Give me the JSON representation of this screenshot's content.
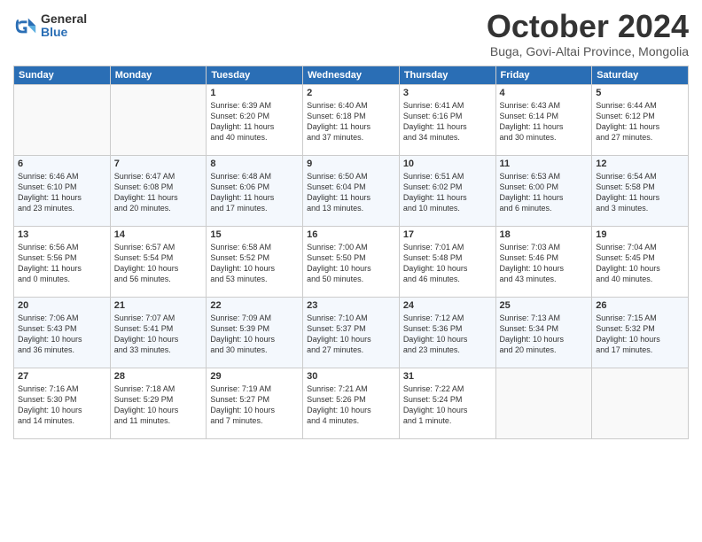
{
  "header": {
    "logo_general": "General",
    "logo_blue": "Blue",
    "month_title": "October 2024",
    "location": "Buga, Govi-Altai Province, Mongolia"
  },
  "days_of_week": [
    "Sunday",
    "Monday",
    "Tuesday",
    "Wednesday",
    "Thursday",
    "Friday",
    "Saturday"
  ],
  "weeks": [
    [
      {
        "day": "",
        "content": ""
      },
      {
        "day": "",
        "content": ""
      },
      {
        "day": "1",
        "content": "Sunrise: 6:39 AM\nSunset: 6:20 PM\nDaylight: 11 hours\nand 40 minutes."
      },
      {
        "day": "2",
        "content": "Sunrise: 6:40 AM\nSunset: 6:18 PM\nDaylight: 11 hours\nand 37 minutes."
      },
      {
        "day": "3",
        "content": "Sunrise: 6:41 AM\nSunset: 6:16 PM\nDaylight: 11 hours\nand 34 minutes."
      },
      {
        "day": "4",
        "content": "Sunrise: 6:43 AM\nSunset: 6:14 PM\nDaylight: 11 hours\nand 30 minutes."
      },
      {
        "day": "5",
        "content": "Sunrise: 6:44 AM\nSunset: 6:12 PM\nDaylight: 11 hours\nand 27 minutes."
      }
    ],
    [
      {
        "day": "6",
        "content": "Sunrise: 6:46 AM\nSunset: 6:10 PM\nDaylight: 11 hours\nand 23 minutes."
      },
      {
        "day": "7",
        "content": "Sunrise: 6:47 AM\nSunset: 6:08 PM\nDaylight: 11 hours\nand 20 minutes."
      },
      {
        "day": "8",
        "content": "Sunrise: 6:48 AM\nSunset: 6:06 PM\nDaylight: 11 hours\nand 17 minutes."
      },
      {
        "day": "9",
        "content": "Sunrise: 6:50 AM\nSunset: 6:04 PM\nDaylight: 11 hours\nand 13 minutes."
      },
      {
        "day": "10",
        "content": "Sunrise: 6:51 AM\nSunset: 6:02 PM\nDaylight: 11 hours\nand 10 minutes."
      },
      {
        "day": "11",
        "content": "Sunrise: 6:53 AM\nSunset: 6:00 PM\nDaylight: 11 hours\nand 6 minutes."
      },
      {
        "day": "12",
        "content": "Sunrise: 6:54 AM\nSunset: 5:58 PM\nDaylight: 11 hours\nand 3 minutes."
      }
    ],
    [
      {
        "day": "13",
        "content": "Sunrise: 6:56 AM\nSunset: 5:56 PM\nDaylight: 11 hours\nand 0 minutes."
      },
      {
        "day": "14",
        "content": "Sunrise: 6:57 AM\nSunset: 5:54 PM\nDaylight: 10 hours\nand 56 minutes."
      },
      {
        "day": "15",
        "content": "Sunrise: 6:58 AM\nSunset: 5:52 PM\nDaylight: 10 hours\nand 53 minutes."
      },
      {
        "day": "16",
        "content": "Sunrise: 7:00 AM\nSunset: 5:50 PM\nDaylight: 10 hours\nand 50 minutes."
      },
      {
        "day": "17",
        "content": "Sunrise: 7:01 AM\nSunset: 5:48 PM\nDaylight: 10 hours\nand 46 minutes."
      },
      {
        "day": "18",
        "content": "Sunrise: 7:03 AM\nSunset: 5:46 PM\nDaylight: 10 hours\nand 43 minutes."
      },
      {
        "day": "19",
        "content": "Sunrise: 7:04 AM\nSunset: 5:45 PM\nDaylight: 10 hours\nand 40 minutes."
      }
    ],
    [
      {
        "day": "20",
        "content": "Sunrise: 7:06 AM\nSunset: 5:43 PM\nDaylight: 10 hours\nand 36 minutes."
      },
      {
        "day": "21",
        "content": "Sunrise: 7:07 AM\nSunset: 5:41 PM\nDaylight: 10 hours\nand 33 minutes."
      },
      {
        "day": "22",
        "content": "Sunrise: 7:09 AM\nSunset: 5:39 PM\nDaylight: 10 hours\nand 30 minutes."
      },
      {
        "day": "23",
        "content": "Sunrise: 7:10 AM\nSunset: 5:37 PM\nDaylight: 10 hours\nand 27 minutes."
      },
      {
        "day": "24",
        "content": "Sunrise: 7:12 AM\nSunset: 5:36 PM\nDaylight: 10 hours\nand 23 minutes."
      },
      {
        "day": "25",
        "content": "Sunrise: 7:13 AM\nSunset: 5:34 PM\nDaylight: 10 hours\nand 20 minutes."
      },
      {
        "day": "26",
        "content": "Sunrise: 7:15 AM\nSunset: 5:32 PM\nDaylight: 10 hours\nand 17 minutes."
      }
    ],
    [
      {
        "day": "27",
        "content": "Sunrise: 7:16 AM\nSunset: 5:30 PM\nDaylight: 10 hours\nand 14 minutes."
      },
      {
        "day": "28",
        "content": "Sunrise: 7:18 AM\nSunset: 5:29 PM\nDaylight: 10 hours\nand 11 minutes."
      },
      {
        "day": "29",
        "content": "Sunrise: 7:19 AM\nSunset: 5:27 PM\nDaylight: 10 hours\nand 7 minutes."
      },
      {
        "day": "30",
        "content": "Sunrise: 7:21 AM\nSunset: 5:26 PM\nDaylight: 10 hours\nand 4 minutes."
      },
      {
        "day": "31",
        "content": "Sunrise: 7:22 AM\nSunset: 5:24 PM\nDaylight: 10 hours\nand 1 minute."
      },
      {
        "day": "",
        "content": ""
      },
      {
        "day": "",
        "content": ""
      }
    ]
  ]
}
